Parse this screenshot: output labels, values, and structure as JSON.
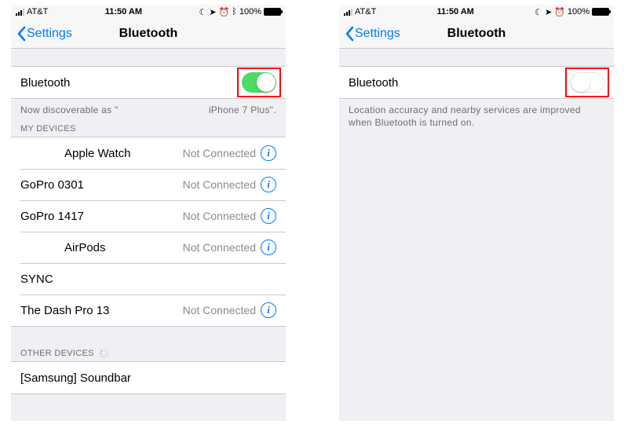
{
  "statusbar": {
    "carrier": "AT&T",
    "time": "11:50 AM",
    "battery_pct": "100%",
    "icons": [
      "no-disturb",
      "nav",
      "alarm",
      "bluetooth"
    ]
  },
  "nav": {
    "back_label": "Settings",
    "title": "Bluetooth"
  },
  "left": {
    "toggle_label": "Bluetooth",
    "toggle_on": true,
    "discoverable_prefix": "Now discoverable as \"",
    "discoverable_device": "iPhone 7 Plus\".",
    "my_devices_header": "MY DEVICES",
    "devices": [
      {
        "name": "Apple Watch",
        "status": "Not Connected",
        "info": true,
        "indent": true
      },
      {
        "name": "GoPro 0301",
        "status": "Not Connected",
        "info": true,
        "indent": false
      },
      {
        "name": "GoPro 1417",
        "status": "Not Connected",
        "info": true,
        "indent": false
      },
      {
        "name": "AirPods",
        "status": "Not Connected",
        "info": true,
        "indent": true
      },
      {
        "name": "SYNC",
        "status": "",
        "info": false,
        "indent": false
      },
      {
        "name": "The Dash Pro 13",
        "status": "Not Connected",
        "info": true,
        "indent": false
      }
    ],
    "other_devices_header": "OTHER DEVICES",
    "other_devices": [
      {
        "name": "[Samsung] Soundbar"
      }
    ]
  },
  "right": {
    "toggle_label": "Bluetooth",
    "toggle_on": false,
    "footer_note": "Location accuracy and nearby services are improved when Bluetooth is turned on."
  }
}
